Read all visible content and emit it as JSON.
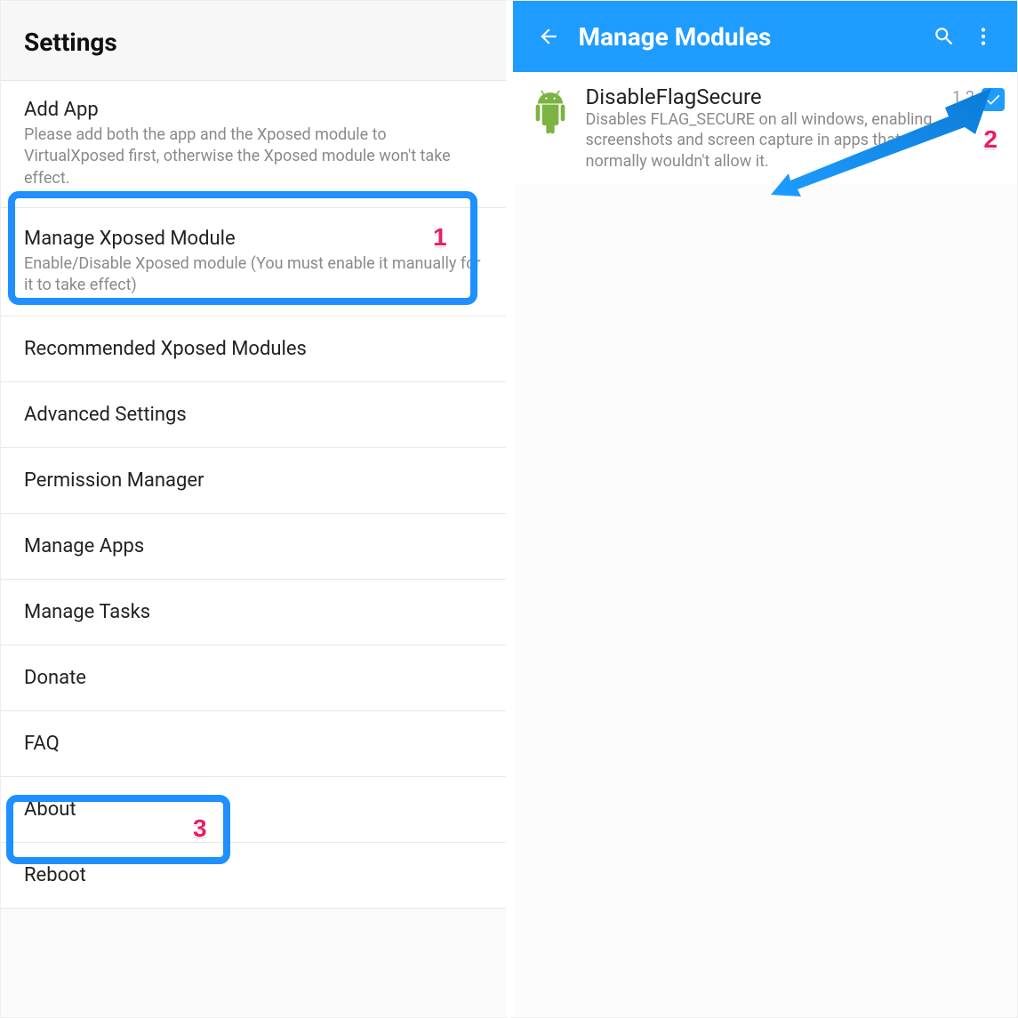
{
  "left": {
    "header": "Settings",
    "items": [
      {
        "title": "Add App",
        "sub": "Please add both the app and the Xposed module to VirtualXposed first, otherwise the Xposed module won't take effect."
      },
      {
        "title": "Manage Xposed Module",
        "sub": "Enable/Disable Xposed module (You must enable it manually for it to take effect)"
      },
      {
        "title": "Recommended Xposed Modules"
      },
      {
        "title": "Advanced Settings"
      },
      {
        "title": "Permission Manager"
      },
      {
        "title": "Manage Apps"
      },
      {
        "title": "Manage Tasks"
      },
      {
        "title": "Donate"
      },
      {
        "title": "FAQ"
      },
      {
        "title": "About"
      },
      {
        "title": "Reboot"
      }
    ]
  },
  "right": {
    "toolbar_title": "Manage Modules",
    "module": {
      "title": "DisableFlagSecure",
      "desc": "Disables FLAG_SECURE on all windows, enabling screenshots and screen capture in apps that normally wouldn't allow it.",
      "version": "1.2"
    }
  },
  "annotations": {
    "step1": "1",
    "step2": "2",
    "step3": "3"
  }
}
